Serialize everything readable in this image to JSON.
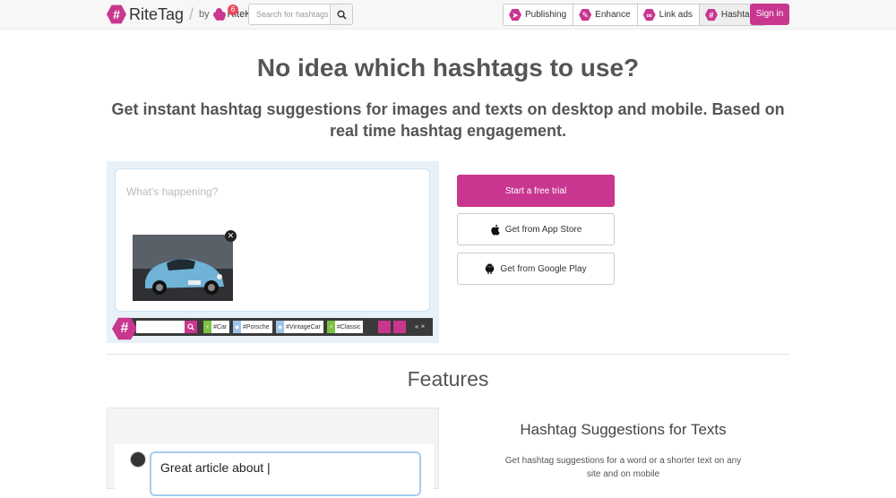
{
  "brand": {
    "name": "RiteTag",
    "by": "by",
    "kit": "RiteKit",
    "badge": "6"
  },
  "search": {
    "placeholder": "Search for hashtags"
  },
  "nav": {
    "items": [
      {
        "label": "Publishing",
        "icon": "paper-plane-icon"
      },
      {
        "label": "Enhance",
        "icon": "pencil-icon"
      },
      {
        "label": "Link ads",
        "icon": "link-icon"
      },
      {
        "label": "Hashtags",
        "icon": "hashtag-icon"
      }
    ],
    "active": "Hashtags"
  },
  "signin": "Sign in",
  "hero": {
    "title": "No idea which hashtags to use?",
    "subtitle": "Get instant hashtag suggestions for images and texts on desktop and mobile. Based on real time hashtag engagement."
  },
  "demo": {
    "placeholder": "What's happening?",
    "tags": [
      {
        "label": "#Car",
        "color": "green"
      },
      {
        "label": "#Porsche",
        "color": "blue"
      },
      {
        "label": "#VintageCar",
        "color": "blue"
      },
      {
        "label": "#Classic",
        "color": "green"
      }
    ],
    "controls": "« ×"
  },
  "cta": {
    "trial": "Start a free trial",
    "appstore": "Get from App Store",
    "googleplay": "Get from Google Play"
  },
  "features": {
    "title": "Features",
    "demo_text": "Great article about |",
    "item_title": "Hashtag Suggestions for Texts",
    "item_desc": "Get hashtag suggestions for a word or a shorter text on any site and on mobile"
  },
  "colors": {
    "brand": "#c8368f",
    "tag_green": "#7cc242",
    "tag_blue": "#9ec3e6"
  }
}
